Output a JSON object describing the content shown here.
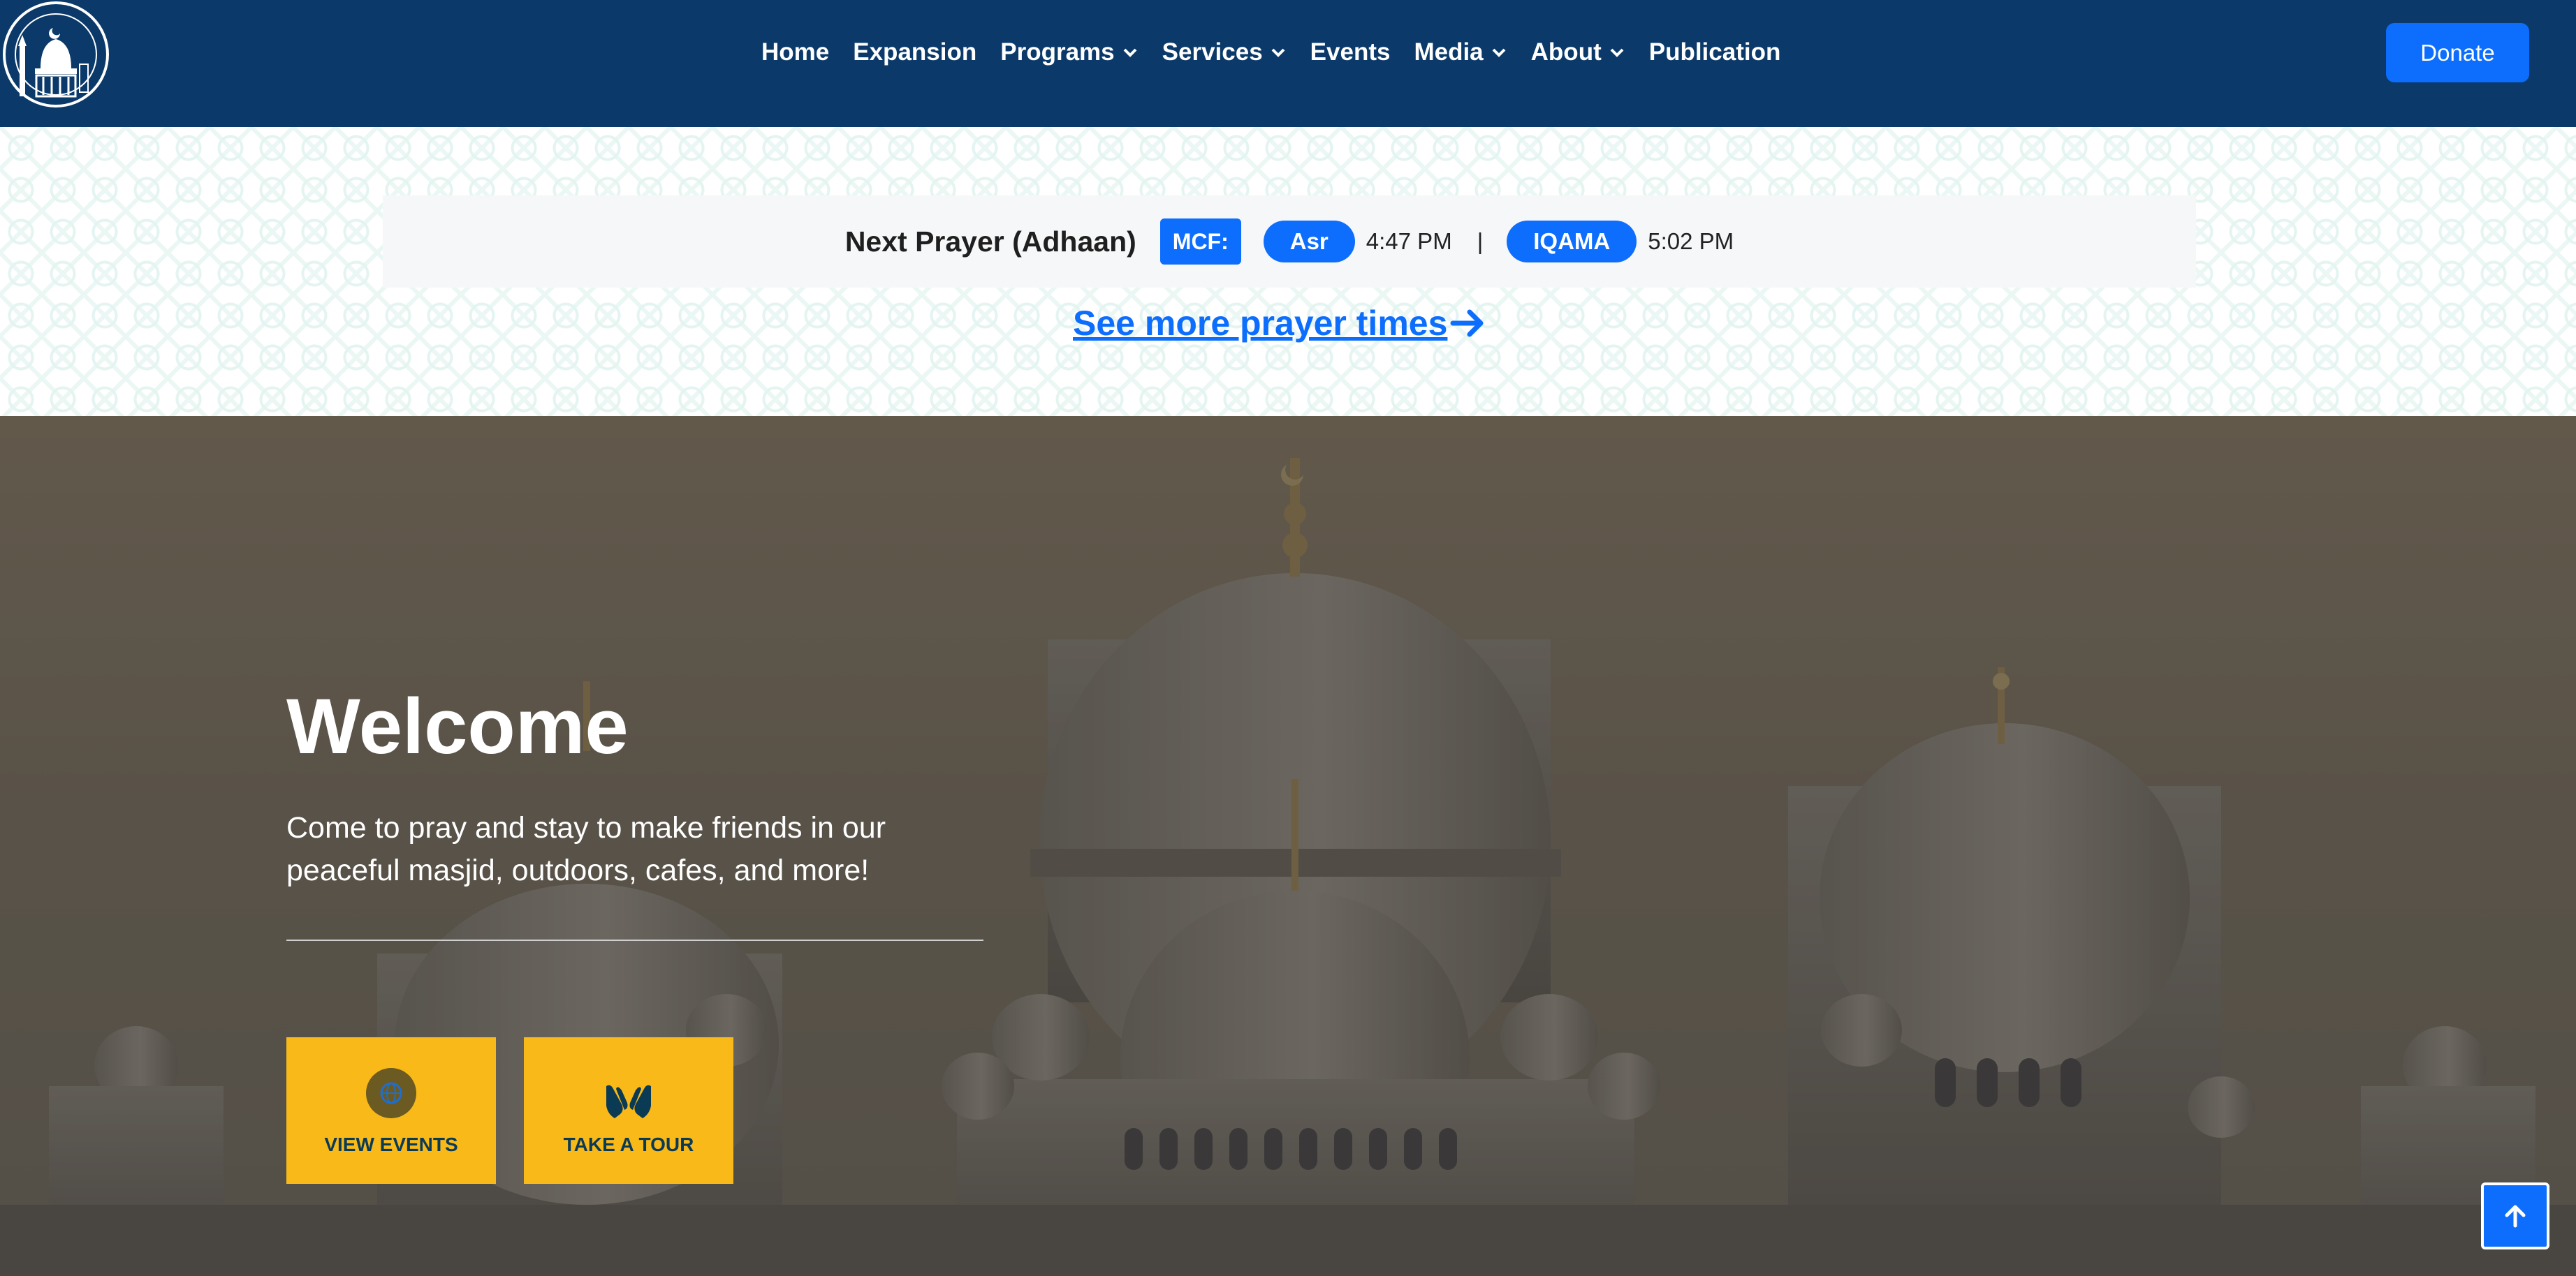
{
  "header": {
    "logo_name": "mosque-logo",
    "nav_items": [
      {
        "label": "Home",
        "has_dropdown": false
      },
      {
        "label": "Expansion",
        "has_dropdown": false
      },
      {
        "label": "Programs",
        "has_dropdown": true
      },
      {
        "label": "Services",
        "has_dropdown": true
      },
      {
        "label": "Events",
        "has_dropdown": false
      },
      {
        "label": "Media",
        "has_dropdown": true
      },
      {
        "label": "About",
        "has_dropdown": true
      },
      {
        "label": "Publication",
        "has_dropdown": false
      }
    ],
    "donate_label": "Donate"
  },
  "prayer": {
    "next_label": "Next Prayer (Adhaan)",
    "location_badge": "MCF:",
    "prayer_name": "Asr",
    "adhaan_time": "4:47 PM",
    "separator": "|",
    "iqama_label": "IQAMA",
    "iqama_time": "5:02 PM",
    "more_link": "See more prayer times "
  },
  "hero": {
    "title": "Welcome",
    "tagline": "Come to pray and stay to make friends in our peaceful masjid, outdoors, cafes, and more!",
    "buttons": [
      {
        "label": "VIEW EVENTS",
        "icon": "globe-icon"
      },
      {
        "label": "TAKE A TOUR",
        "icon": "praying-hands-icon"
      }
    ]
  },
  "colors": {
    "nav_bg": "#0b3a6a",
    "primary": "#0d6efd",
    "cta_bg": "#f8b919",
    "cta_text": "#0b3a55"
  }
}
